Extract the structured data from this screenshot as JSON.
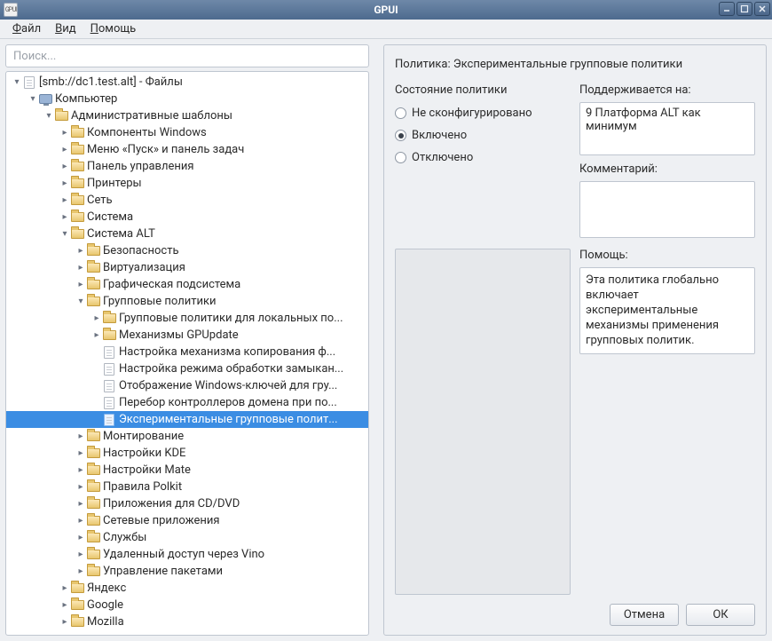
{
  "window": {
    "title": "GPUI",
    "app_icon_text": "GP UI"
  },
  "menu": {
    "file": "Файл",
    "view": "Вид",
    "help": "Помощь"
  },
  "search": {
    "placeholder": "Поиск..."
  },
  "tree": [
    {
      "depth": 0,
      "icon": "doc",
      "exp": "open",
      "label": "[smb://dc1.test.alt] - Файлы"
    },
    {
      "depth": 1,
      "icon": "monitor",
      "exp": "open",
      "label": "Компьютер"
    },
    {
      "depth": 2,
      "icon": "folder",
      "exp": "open",
      "label": "Административные шаблоны"
    },
    {
      "depth": 3,
      "icon": "folder",
      "exp": "closed",
      "label": "Компоненты Windows"
    },
    {
      "depth": 3,
      "icon": "folder",
      "exp": "closed",
      "label": "Меню «Пуск» и панель задач"
    },
    {
      "depth": 3,
      "icon": "folder",
      "exp": "closed",
      "label": "Панель управления"
    },
    {
      "depth": 3,
      "icon": "folder",
      "exp": "closed",
      "label": "Принтеры"
    },
    {
      "depth": 3,
      "icon": "folder",
      "exp": "closed",
      "label": "Сеть"
    },
    {
      "depth": 3,
      "icon": "folder",
      "exp": "closed",
      "label": "Система"
    },
    {
      "depth": 3,
      "icon": "folder",
      "exp": "open",
      "label": "Система ALT"
    },
    {
      "depth": 4,
      "icon": "folder",
      "exp": "closed",
      "label": "Безопасность"
    },
    {
      "depth": 4,
      "icon": "folder",
      "exp": "closed",
      "label": "Виртуализация"
    },
    {
      "depth": 4,
      "icon": "folder",
      "exp": "closed",
      "label": "Графическая подсистема"
    },
    {
      "depth": 4,
      "icon": "folder",
      "exp": "open",
      "label": "Групповые политики"
    },
    {
      "depth": 5,
      "icon": "folder",
      "exp": "closed",
      "label": "Групповые политики для локальных по..."
    },
    {
      "depth": 5,
      "icon": "folder",
      "exp": "closed",
      "label": "Механизмы GPUpdate"
    },
    {
      "depth": 5,
      "icon": "doc",
      "exp": "none",
      "label": "Настройка механизма копирования ф..."
    },
    {
      "depth": 5,
      "icon": "doc",
      "exp": "none",
      "label": "Настройка режима обработки замыкан..."
    },
    {
      "depth": 5,
      "icon": "doc",
      "exp": "none",
      "label": "Отображение Windows-ключей для гру..."
    },
    {
      "depth": 5,
      "icon": "doc",
      "exp": "none",
      "label": "Перебор контроллеров домена при по..."
    },
    {
      "depth": 5,
      "icon": "doc",
      "exp": "none",
      "label": "Экспериментальные групповые полит...",
      "selected": true
    },
    {
      "depth": 4,
      "icon": "folder",
      "exp": "closed",
      "label": "Монтирование"
    },
    {
      "depth": 4,
      "icon": "folder",
      "exp": "closed",
      "label": "Настройки KDE"
    },
    {
      "depth": 4,
      "icon": "folder",
      "exp": "closed",
      "label": "Настройки Mate"
    },
    {
      "depth": 4,
      "icon": "folder",
      "exp": "closed",
      "label": "Правила Polkit"
    },
    {
      "depth": 4,
      "icon": "folder",
      "exp": "closed",
      "label": "Приложения для CD/DVD"
    },
    {
      "depth": 4,
      "icon": "folder",
      "exp": "closed",
      "label": "Сетевые приложения"
    },
    {
      "depth": 4,
      "icon": "folder",
      "exp": "closed",
      "label": "Службы"
    },
    {
      "depth": 4,
      "icon": "folder",
      "exp": "closed",
      "label": "Удаленный доступ через Vino"
    },
    {
      "depth": 4,
      "icon": "folder",
      "exp": "closed",
      "label": "Управление пакетами"
    },
    {
      "depth": 3,
      "icon": "folder",
      "exp": "closed",
      "label": "Яндекс"
    },
    {
      "depth": 3,
      "icon": "folder",
      "exp": "closed",
      "label": "Google"
    },
    {
      "depth": 3,
      "icon": "folder",
      "exp": "closed",
      "label": "Mozilla"
    }
  ],
  "details": {
    "policy_title": "Политика: Экспериментальные групповые политики",
    "state_label": "Состояние политики",
    "state_options": {
      "not_configured": {
        "label": "Не сконфигурировано",
        "checked": false
      },
      "enabled": {
        "label": "Включено",
        "checked": true
      },
      "disabled": {
        "label": "Отключено",
        "checked": false
      }
    },
    "supported_label": "Поддерживается на:",
    "supported_value": "9 Платформа ALT как минимум",
    "comment_label": "Комментарий:",
    "comment_value": "",
    "help_label": "Помощь:",
    "help_value": "Эта политика глобально включает экспериментальные механизмы применения групповых политик.",
    "buttons": {
      "cancel": "Отмена",
      "ok": "ОК"
    }
  }
}
